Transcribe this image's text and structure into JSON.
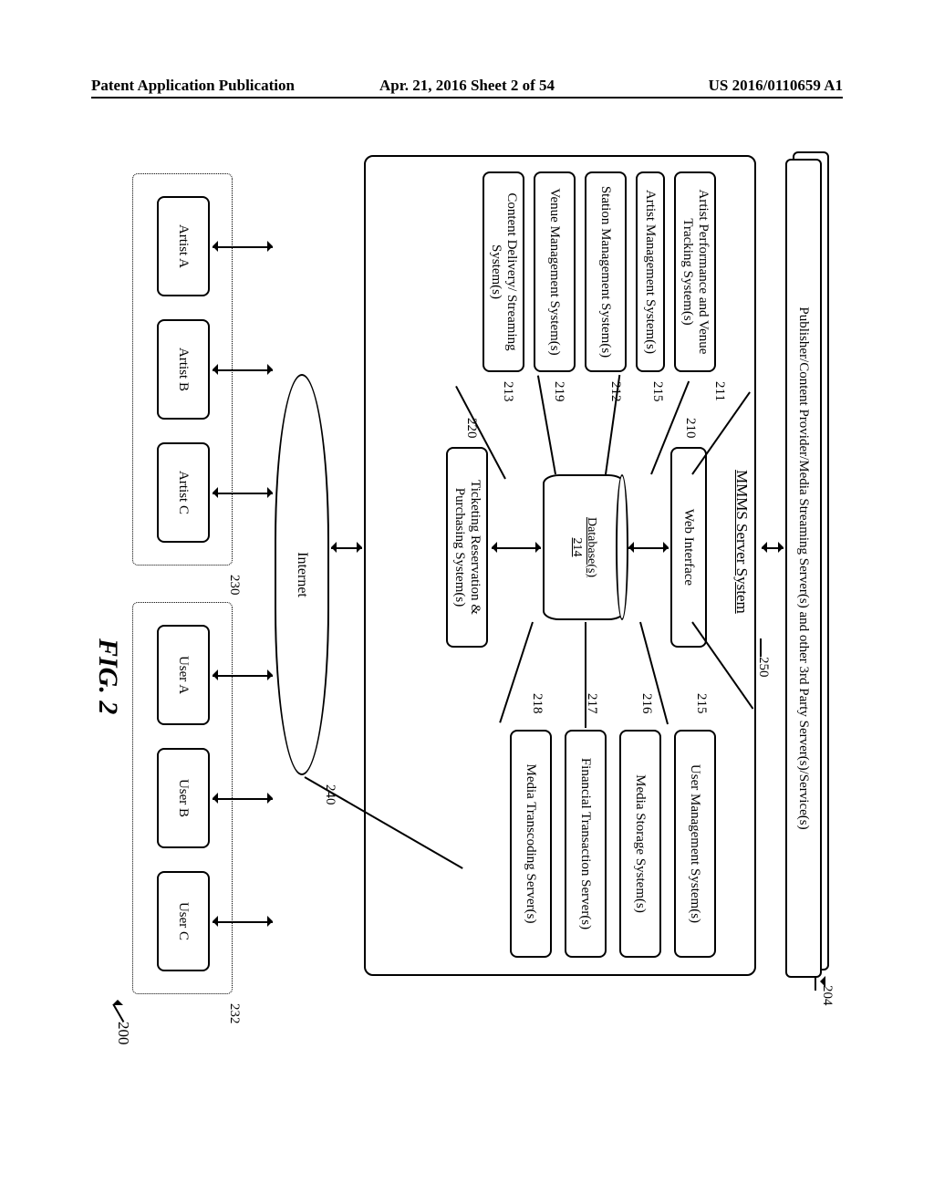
{
  "header": {
    "left": "Patent Application Publication",
    "center": "Apr. 21, 2016  Sheet 2 of 54",
    "right": "US 2016/0110659 A1"
  },
  "figure_caption": "FIG. 2",
  "refs": {
    "overall": "200",
    "publishers": "204",
    "mmms_title_leader": "250",
    "mmms_title": "MMMS Server System",
    "web_interface": "210",
    "artist_perf": "211",
    "station_mgmt": "212",
    "content_delivery": "213",
    "database": "214",
    "user_mgmt": "215",
    "artist_mgmt": "215",
    "media_storage": "216",
    "fin_trans": "217",
    "media_transcode": "218",
    "venue_mgmt": "219",
    "ticketing": "220",
    "artists_group": "230",
    "users_group": "232",
    "internet": "240"
  },
  "boxes": {
    "publishers": "Publisher/Content Provider/Media Streaming Server(s) and other 3rd Party Server(s)/Service(s)",
    "mmms_title": "MMMS Server System",
    "web_interface": "Web Interface",
    "artist_perf": "Artist Performance and Venue Tracking System(s)",
    "artist_mgmt": "Artist Management System(s)",
    "station_mgmt": "Station Management System(s)",
    "venue_mgmt": "Venue Management System(s)",
    "content_delivery": "Content Delivery/ Streaming System(s)",
    "database": "Database(s)",
    "database_ref": "214",
    "ticketing": "Ticketing Reservation & Purchasing System(s)",
    "user_mgmt": "User Management System(s)",
    "media_storage": "Media Storage System(s)",
    "fin_trans": "Financial Transaction Server(s)",
    "media_transcode": "Media Transcoding Server(s)",
    "internet": "Internet",
    "artist_a": "Artist A",
    "artist_b": "Artist B",
    "artist_c": "Artist C",
    "user_a": "User A",
    "user_b": "User B",
    "user_c": "User C"
  }
}
